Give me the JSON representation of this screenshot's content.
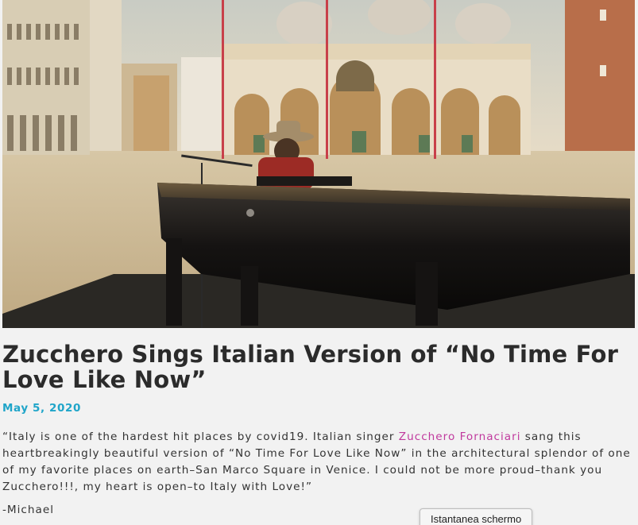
{
  "hero_image": {
    "description_icon": "video-still-image"
  },
  "article": {
    "title": "Zucchero Sings Italian Version of “No Time For Love Like Now”",
    "date": "May 5, 2020",
    "body_before_link": "“Italy is one of the hardest hit places by covid19. Italian singer ",
    "link_text": "Zucchero Fornaciari",
    "body_after_link": " sang this heartbreakingly beautiful version of “No Time For Love Like Now” in the architectural splendor of one of my favorite places on earth–San Marco Square in Venice. I could not be more proud–thank you Zucchero!!!, my heart is open–to Italy with Love!”",
    "signature": "-Michael"
  },
  "tooltip": {
    "label": "Istantanea schermo"
  },
  "colors": {
    "title": "#2b2b2b",
    "date": "#1fa5c9",
    "link": "#c0399d",
    "body": "#333333",
    "background": "#f2f2f2"
  }
}
